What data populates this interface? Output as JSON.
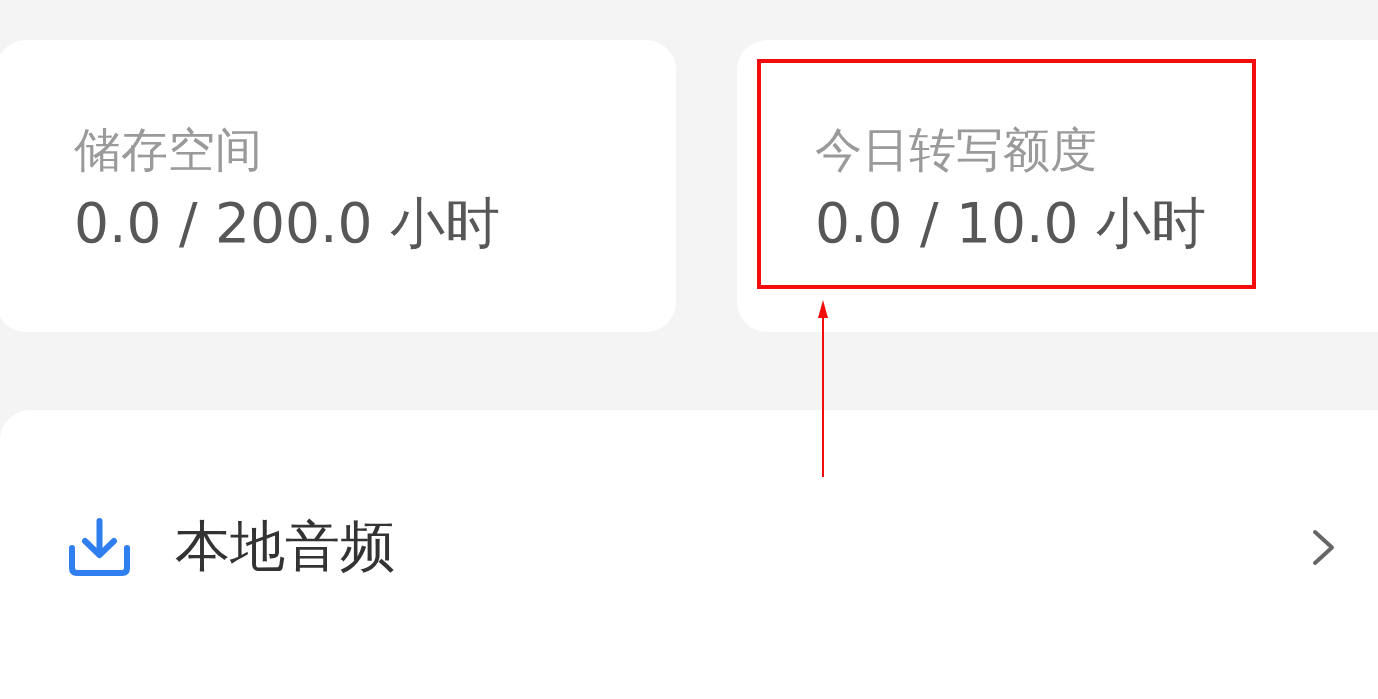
{
  "stats": [
    {
      "label": "储存空间",
      "value": "0.0 / 200.0 小时",
      "highlighted": false
    },
    {
      "label": "今日转写额度",
      "value": "0.0 / 10.0 小时",
      "highlighted": true
    }
  ],
  "list": [
    {
      "label": "本地音频"
    }
  ]
}
